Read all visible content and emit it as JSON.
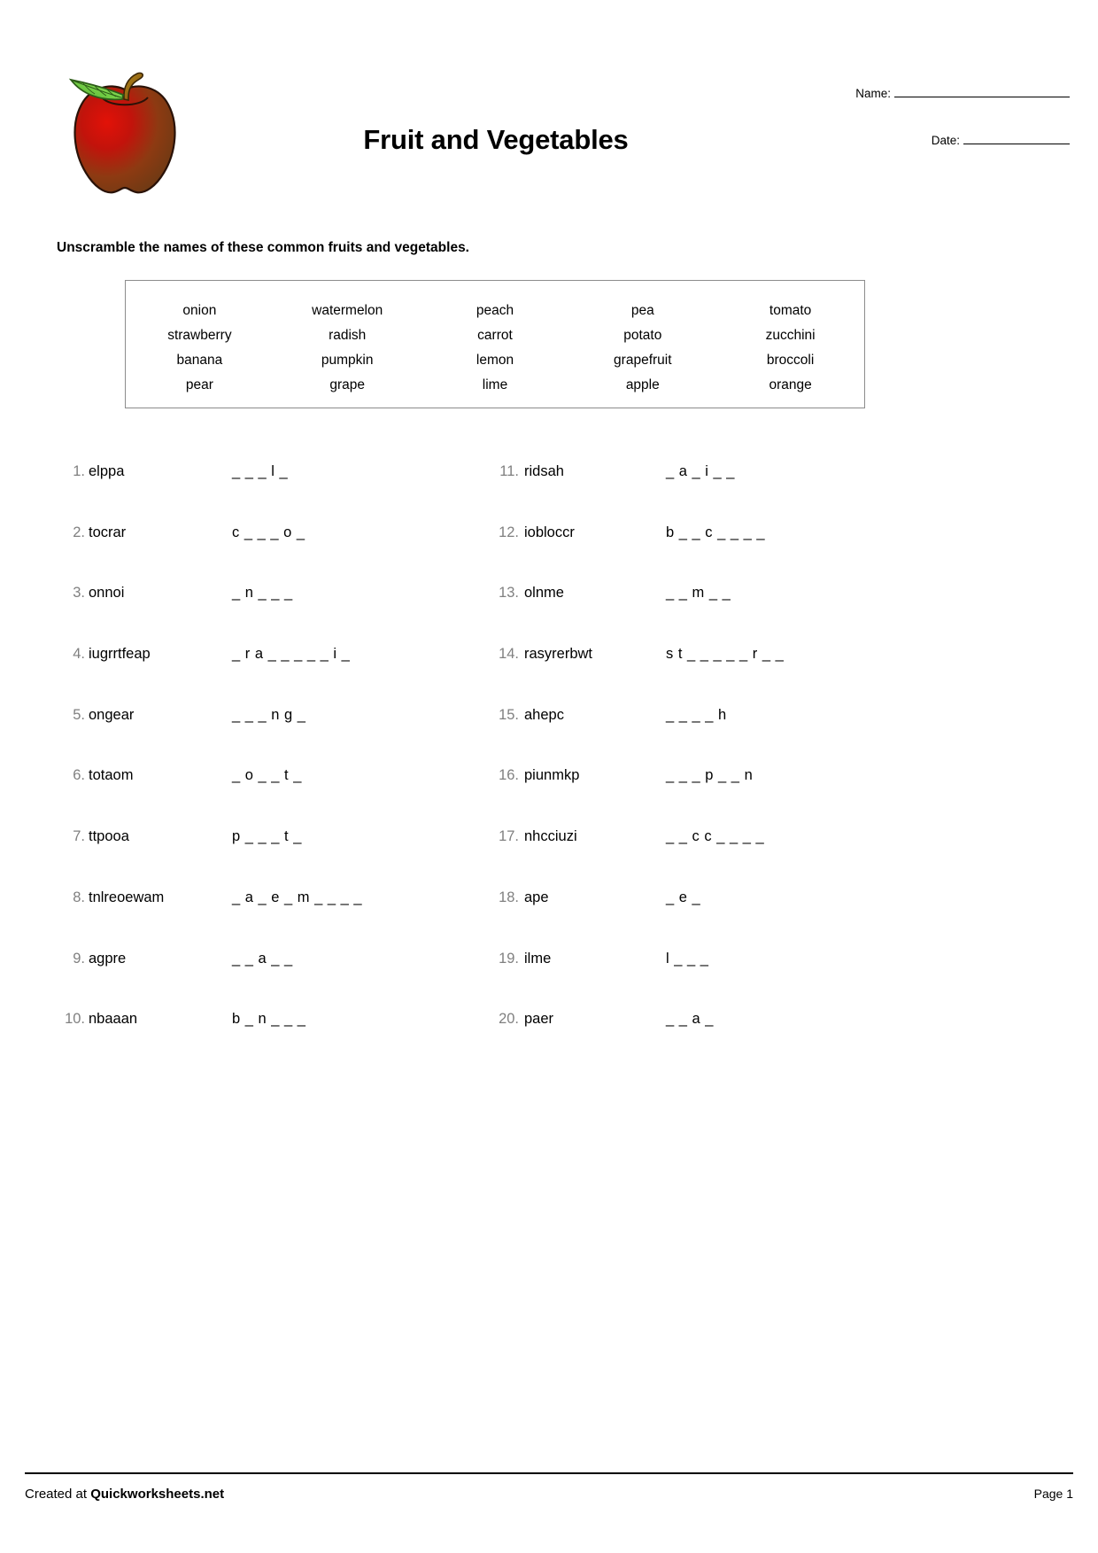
{
  "header": {
    "title": "Fruit and Vegetables",
    "name_label": "Name:",
    "date_label": "Date:",
    "logo_alt": "apple-illustration"
  },
  "instruction": "Unscramble the names of these common fruits and vegetables.",
  "word_bank": {
    "rows": [
      [
        "onion",
        "watermelon",
        "peach",
        "pea",
        "tomato"
      ],
      [
        "strawberry",
        "radish",
        "carrot",
        "potato",
        "zucchini"
      ],
      [
        "banana",
        "pumpkin",
        "lemon",
        "grapefruit",
        "broccoli"
      ],
      [
        "pear",
        "grape",
        "lime",
        "apple",
        "orange"
      ]
    ]
  },
  "puzzle": {
    "left_column": [
      {
        "number": "1.",
        "scrambled": "elppa",
        "pattern": "_ _ _ l _"
      },
      {
        "number": "2.",
        "scrambled": "tocrar",
        "pattern": "c _ _ _ o _"
      },
      {
        "number": "3.",
        "scrambled": "onnoi",
        "pattern": "_ n _ _ _"
      },
      {
        "number": "4.",
        "scrambled": "iugrrtfeap",
        "pattern": "_ r a _ _ _ _ _ i _"
      },
      {
        "number": "5.",
        "scrambled": "ongear",
        "pattern": "_ _ _ n g _"
      },
      {
        "number": "6.",
        "scrambled": "totaom",
        "pattern": "_ o _ _ t _"
      },
      {
        "number": "7.",
        "scrambled": "ttpooa",
        "pattern": "p _ _ _ t _"
      },
      {
        "number": "8.",
        "scrambled": "tnlreoewam",
        "pattern": "_ a _ e _ m _ _ _ _"
      },
      {
        "number": "9.",
        "scrambled": "agpre",
        "pattern": "_ _ a _ _"
      },
      {
        "number": "10.",
        "scrambled": "nbaaan",
        "pattern": "b _ n _ _ _"
      }
    ],
    "right_column": [
      {
        "number": "11.",
        "scrambled": "ridsah",
        "pattern": "_ a _ i _ _"
      },
      {
        "number": "12.",
        "scrambled": "iobloccr",
        "pattern": "b _ _ c _ _ _ _"
      },
      {
        "number": "13.",
        "scrambled": "olnme",
        "pattern": "_ _ m _ _"
      },
      {
        "number": "14.",
        "scrambled": "rasyrerbwt",
        "pattern": "s t _ _ _ _ _ r _ _"
      },
      {
        "number": "15.",
        "scrambled": "ahepc",
        "pattern": "_ _ _ _ h"
      },
      {
        "number": "16.",
        "scrambled": "piunmkp",
        "pattern": "_ _ _ p _ _ n"
      },
      {
        "number": "17.",
        "scrambled": "nhcciuzi",
        "pattern": "_ _ c c _ _ _ _"
      },
      {
        "number": "18.",
        "scrambled": "ape",
        "pattern": "_ e _"
      },
      {
        "number": "19.",
        "scrambled": "ilme",
        "pattern": "l _ _ _"
      },
      {
        "number": "20.",
        "scrambled": "paer",
        "pattern": "_ _ a _"
      }
    ]
  },
  "footer": {
    "created_label": "Created at ",
    "site_name": "Quickworksheets.net",
    "page_label": "Page 1"
  },
  "colors": {
    "number_gray": "#808080",
    "box_border": "#8c8c8c",
    "text_black": "#000000",
    "apple_red": "#c9180f",
    "apple_dark": "#6b3a14",
    "leaf_green": "#66c23a",
    "stem_brown": "#9a6b12"
  }
}
